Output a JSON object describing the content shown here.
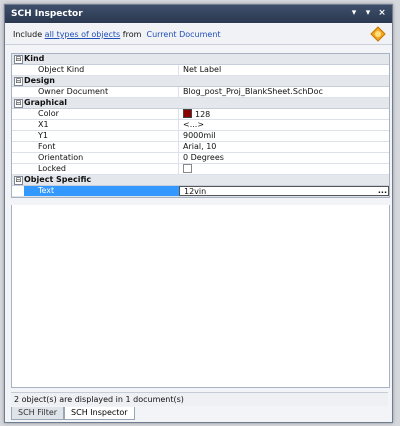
{
  "window": {
    "title": "SCH Inspector"
  },
  "titlebar_controls": {
    "menu": "▾",
    "pin": "▾",
    "close": "×"
  },
  "filter": {
    "prefix": "Include",
    "scope_link": "all types of objects",
    "middle": "from",
    "source_link": "Current Document",
    "icon": "bulb-icon"
  },
  "sections": [
    {
      "title": "Kind",
      "rows": [
        {
          "key": "Object Kind",
          "value": "Net Label"
        }
      ]
    },
    {
      "title": "Design",
      "rows": [
        {
          "key": "Owner Document",
          "value": "Blog_post_Proj_BlankSheet.SchDoc"
        }
      ]
    },
    {
      "title": "Graphical",
      "rows": [
        {
          "key": "Color",
          "value": "128",
          "swatch": "#8b0000"
        },
        {
          "key": "X1",
          "value": "<...>"
        },
        {
          "key": "Y1",
          "value": "9000mil"
        },
        {
          "key": "Font",
          "value": "Arial, 10"
        },
        {
          "key": "Orientation",
          "value": "0 Degrees"
        },
        {
          "key": "Locked",
          "value": ""
        }
      ]
    },
    {
      "title": "Object Specific",
      "rows": [
        {
          "key": "Text",
          "value": "12vin",
          "selected": true
        }
      ]
    }
  ],
  "toggle_symbol": "⊟",
  "edit_button": "...",
  "status": "2 object(s) are displayed in 1 document(s)",
  "tabs": [
    "SCH Filter",
    "SCH Inspector"
  ],
  "colors": {
    "title_bg": "#2f3d57",
    "selection": "#3399ff",
    "link": "#1f4fb8"
  }
}
